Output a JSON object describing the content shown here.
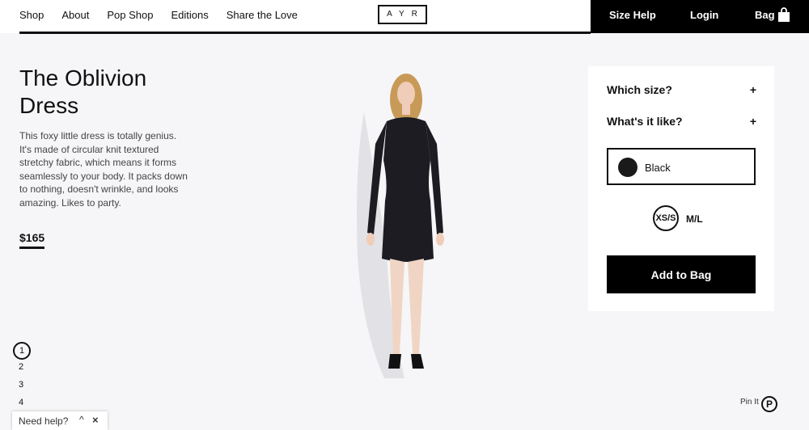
{
  "nav": {
    "items": [
      "Shop",
      "About",
      "Pop Shop",
      "Editions",
      "Share the Love"
    ],
    "logo": "AYR",
    "size_help": "Size Help",
    "login": "Login",
    "bag": "Bag"
  },
  "product": {
    "title": "The Oblivion Dress",
    "description": "This foxy little dress is totally genius. It's made of circular knit textured stretchy fabric, which means it forms seamlessly to your body. It packs down to nothing, doesn't wrinkle, and looks amazing. Likes to party.",
    "price": "$165"
  },
  "panel": {
    "which_size": "Which size?",
    "what_like": "What's it like?",
    "expand_symbol": "+",
    "color_name": "Black",
    "color_hex": "#1a1a1a",
    "sizes": [
      "XS/S",
      "M/L"
    ],
    "selected_size": "XS/S",
    "add_to_bag": "Add to Bag"
  },
  "pager": [
    "1",
    "2",
    "3",
    "4"
  ],
  "help": {
    "label": "Need help?",
    "up": "^",
    "close": "×"
  },
  "pin": "Pin It",
  "pin_glyph": "P"
}
